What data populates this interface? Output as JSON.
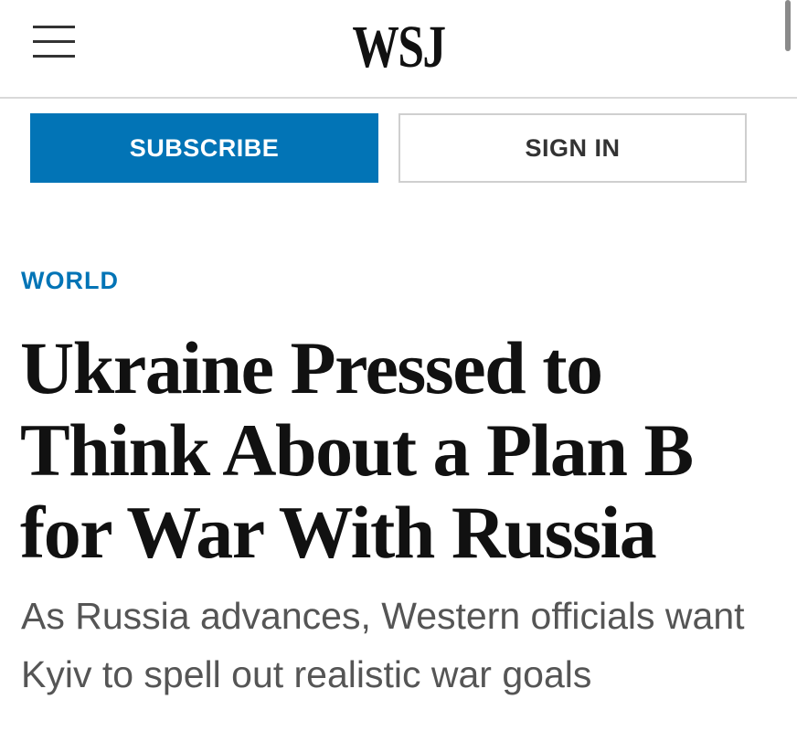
{
  "header": {
    "logo_text": "WSJ",
    "menu_icon": "hamburger-menu-icon"
  },
  "actions": {
    "subscribe_label": "SUBSCRIBE",
    "signin_label": "SIGN IN"
  },
  "article": {
    "section": "WORLD",
    "headline": "Ukraine Pressed to Think About a Plan B for War With Russia",
    "dek": "As Russia advances, Western officials want Kyiv to spell out realistic war goals"
  },
  "colors": {
    "brand_blue": "#0274b6",
    "text_dark": "#111111",
    "dek_gray": "#555555"
  }
}
